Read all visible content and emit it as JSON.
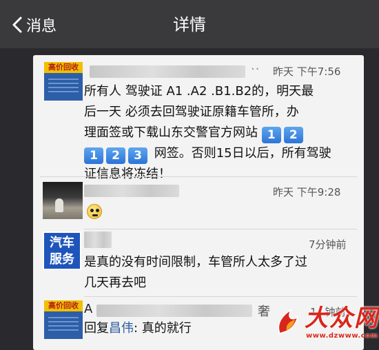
{
  "navbar": {
    "back_label": "消息",
    "title": "详情"
  },
  "posts": [
    {
      "avatar_text": "高价回收",
      "time": "昨天 下午7:56",
      "more": "··",
      "text": {
        "line1": "所有人 驾驶证 A1 .A2 .B1.B2的，明天最",
        "line2": "后一天 必须去回驾驶证原籍车管所，办",
        "line3_prefix": "理面签或下载山东交警官方网站 ",
        "line4_suffix": " 网签。否则15日以后，所有驾驶",
        "line5": "证信息将冻结！"
      },
      "keys": [
        "1",
        "2",
        "1",
        "2",
        "3"
      ]
    }
  ],
  "comments": [
    {
      "time": "昨天 下午9:28",
      "emoji": "emoji-face"
    },
    {
      "avatar_line1": "汽车",
      "avatar_line2": "服务",
      "time": "7分钟前",
      "text_line1": "是真的没有时间限制，车管所人太多了过",
      "text_line2": "几天再去吧"
    },
    {
      "avatar_text": "高价回收",
      "name_initial": "A",
      "name_tail": "奢",
      "time_partial": "1",
      "time_tail": "钟前",
      "reply_prefix": "回复",
      "reply_to": "昌伟",
      "reply_text": ": 真的就行"
    }
  ],
  "watermark": {
    "text": "大众网",
    "url": "www.dzwww.com"
  }
}
